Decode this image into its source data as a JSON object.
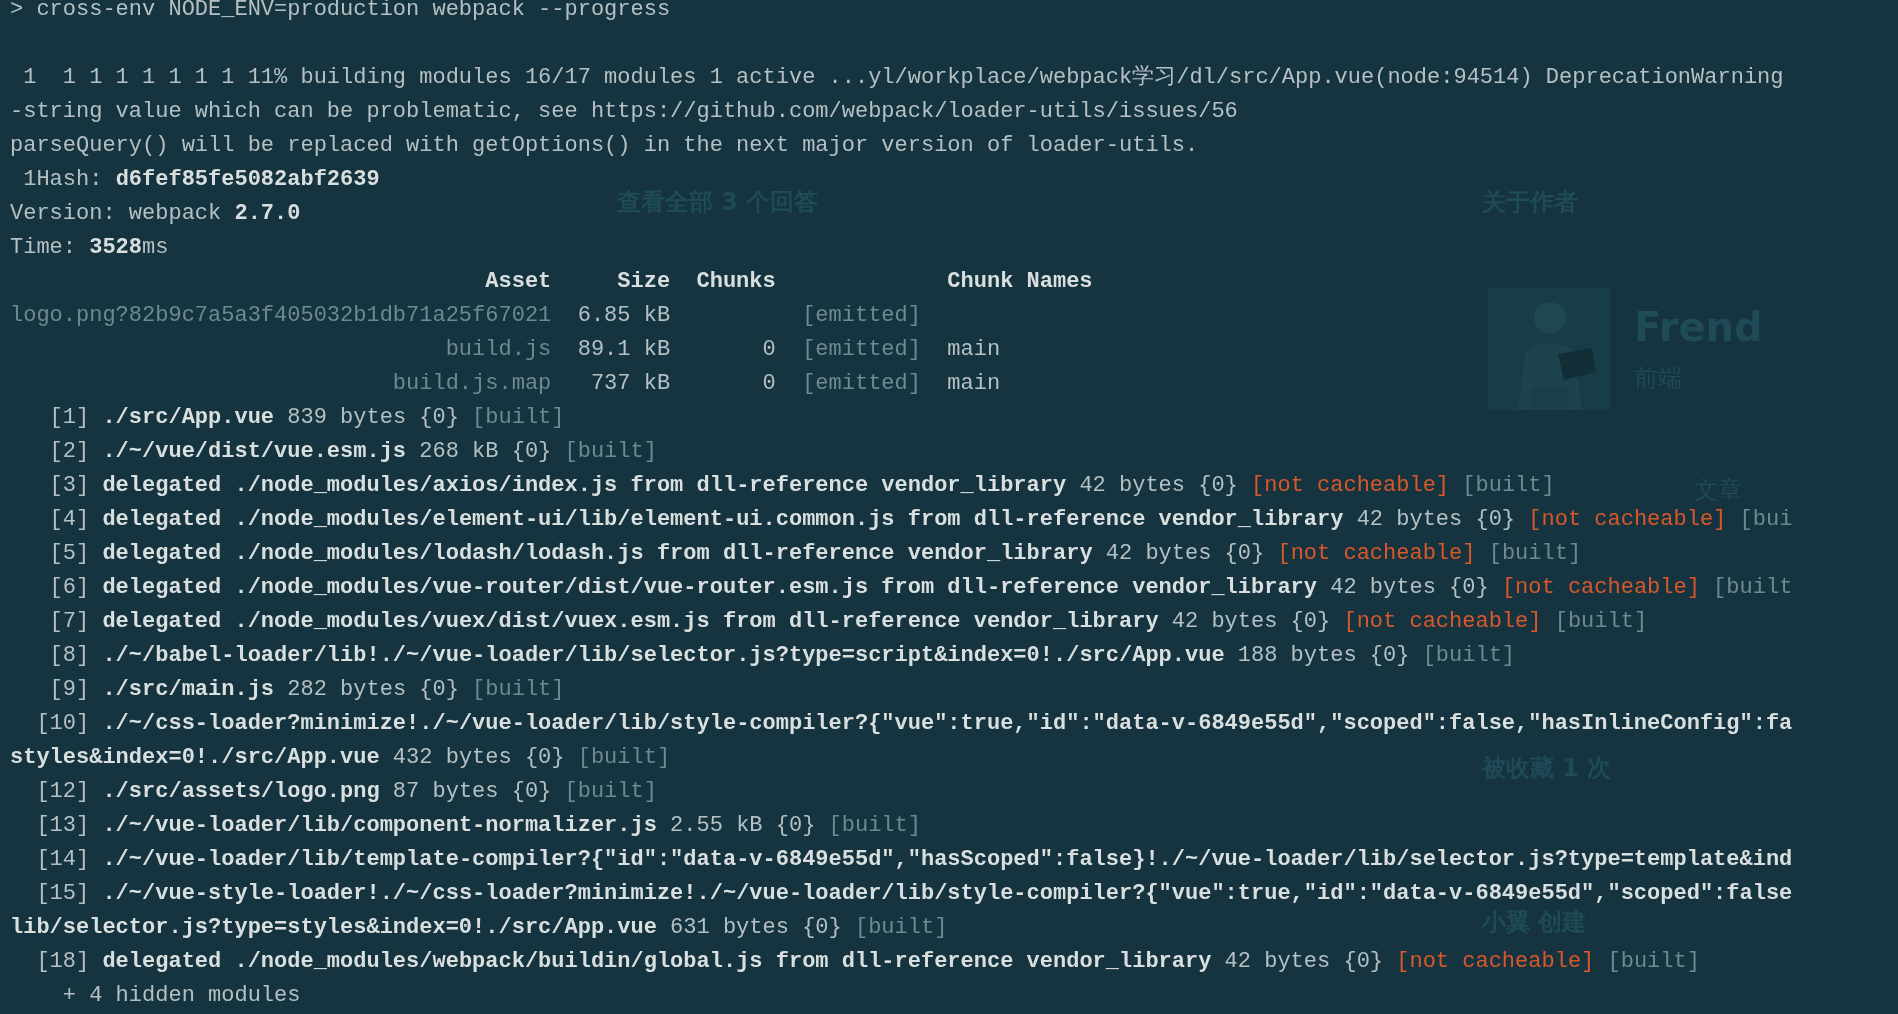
{
  "background_page": {
    "texts": [
      {
        "kind": "heading",
        "text": "查看全部 3 个回答"
      },
      {
        "kind": "heading",
        "text": "关于作者"
      },
      {
        "kind": "name",
        "text": "Frend"
      },
      {
        "kind": "label",
        "text": "前端"
      },
      {
        "kind": "label",
        "text": "文章"
      },
      {
        "kind": "heading",
        "text": "被收藏 1 次"
      },
      {
        "kind": "heading",
        "text": "小翼 创建"
      }
    ]
  },
  "terminal": {
    "lines": [
      {
        "kind": "text",
        "segments": [
          {
            "kind": "plain",
            "text": "> cross-env NODE_ENV=production webpack --progress"
          }
        ]
      },
      {
        "kind": "blank"
      },
      {
        "kind": "text",
        "segments": [
          {
            "kind": "plain",
            "text": " 1  1 1 1 1 1 1 1 11% building modules 16/17 modules 1 active ...yl/workplace/webpack学习/dl/src/App.vue(node:94514) DeprecationWarning"
          }
        ]
      },
      {
        "kind": "text",
        "segments": [
          {
            "kind": "plain",
            "text": "-string value which can be problematic, see https://github.com/webpack/loader-utils/issues/56"
          }
        ]
      },
      {
        "kind": "text",
        "segments": [
          {
            "kind": "plain",
            "text": "parseQuery() will be replaced with getOptions() in the next major version of loader-utils."
          }
        ]
      },
      {
        "kind": "text",
        "segments": [
          {
            "kind": "plain",
            "text": " 1Hash: "
          },
          {
            "kind": "bold",
            "text": "d6fef85fe5082abf2639"
          }
        ]
      },
      {
        "kind": "text",
        "segments": [
          {
            "kind": "plain",
            "text": "Version: webpack "
          },
          {
            "kind": "bold",
            "text": "2.7.0"
          }
        ]
      },
      {
        "kind": "text",
        "segments": [
          {
            "kind": "plain",
            "text": "Time: "
          },
          {
            "kind": "bold",
            "text": "3528"
          },
          {
            "kind": "plain",
            "text": "ms"
          }
        ]
      },
      {
        "kind": "text",
        "segments": [
          {
            "kind": "bold",
            "text": "                                    Asset     Size  Chunks             Chunk Names"
          }
        ]
      },
      {
        "kind": "text",
        "segments": [
          {
            "kind": "dim",
            "text": "logo.png?82b9c7a5a3f405032b1db71a25f67021"
          },
          {
            "kind": "plain",
            "text": "  6.85 kB        "
          },
          {
            "kind": "dim",
            "text": "  [emitted]"
          }
        ]
      },
      {
        "kind": "text",
        "segments": [
          {
            "kind": "dim",
            "text": "                                 build.js"
          },
          {
            "kind": "plain",
            "text": "  89.1 kB       0"
          },
          {
            "kind": "dim",
            "text": "  [emitted]"
          },
          {
            "kind": "plain",
            "text": "  main"
          }
        ]
      },
      {
        "kind": "text",
        "segments": [
          {
            "kind": "dim",
            "text": "                             build.js.map"
          },
          {
            "kind": "plain",
            "text": "   737 kB       0"
          },
          {
            "kind": "dim",
            "text": "  [emitted]"
          },
          {
            "kind": "plain",
            "text": "  main"
          }
        ]
      },
      {
        "kind": "text",
        "segments": [
          {
            "kind": "plain",
            "text": "   [1] "
          },
          {
            "kind": "bold",
            "text": "./src/App.vue"
          },
          {
            "kind": "plain",
            "text": " 839 bytes {0} "
          },
          {
            "kind": "dim",
            "text": "[built]"
          }
        ]
      },
      {
        "kind": "text",
        "segments": [
          {
            "kind": "plain",
            "text": "   [2] "
          },
          {
            "kind": "bold",
            "text": "./~/vue/dist/vue.esm.js"
          },
          {
            "kind": "plain",
            "text": " 268 kB {0} "
          },
          {
            "kind": "dim",
            "text": "[built]"
          }
        ]
      },
      {
        "kind": "text",
        "segments": [
          {
            "kind": "plain",
            "text": "   [3] "
          },
          {
            "kind": "bold",
            "text": "delegated ./node_modules/axios/index.js from dll-reference vendor_library"
          },
          {
            "kind": "plain",
            "text": " 42 bytes {0} "
          },
          {
            "kind": "warn",
            "text": "[not cacheable]"
          },
          {
            "kind": "dim",
            "text": " [built]"
          }
        ]
      },
      {
        "kind": "text",
        "segments": [
          {
            "kind": "plain",
            "text": "   [4] "
          },
          {
            "kind": "bold",
            "text": "delegated ./node_modules/element-ui/lib/element-ui.common.js from dll-reference vendor_library"
          },
          {
            "kind": "plain",
            "text": " 42 bytes {0} "
          },
          {
            "kind": "warn",
            "text": "[not cacheable]"
          },
          {
            "kind": "dim",
            "text": " [bui"
          }
        ]
      },
      {
        "kind": "text",
        "segments": [
          {
            "kind": "plain",
            "text": "   [5] "
          },
          {
            "kind": "bold",
            "text": "delegated ./node_modules/lodash/lodash.js from dll-reference vendor_library"
          },
          {
            "kind": "plain",
            "text": " 42 bytes {0} "
          },
          {
            "kind": "warn",
            "text": "[not cacheable]"
          },
          {
            "kind": "dim",
            "text": " [built]"
          }
        ]
      },
      {
        "kind": "text",
        "segments": [
          {
            "kind": "plain",
            "text": "   [6] "
          },
          {
            "kind": "bold",
            "text": "delegated ./node_modules/vue-router/dist/vue-router.esm.js from dll-reference vendor_library"
          },
          {
            "kind": "plain",
            "text": " 42 bytes {0} "
          },
          {
            "kind": "warn",
            "text": "[not cacheable]"
          },
          {
            "kind": "dim",
            "text": " [built"
          }
        ]
      },
      {
        "kind": "text",
        "segments": [
          {
            "kind": "plain",
            "text": "   [7] "
          },
          {
            "kind": "bold",
            "text": "delegated ./node_modules/vuex/dist/vuex.esm.js from dll-reference vendor_library"
          },
          {
            "kind": "plain",
            "text": " 42 bytes {0} "
          },
          {
            "kind": "warn",
            "text": "[not cacheable]"
          },
          {
            "kind": "dim",
            "text": " [built]"
          }
        ]
      },
      {
        "kind": "text",
        "segments": [
          {
            "kind": "plain",
            "text": "   [8] "
          },
          {
            "kind": "bold",
            "text": "./~/babel-loader/lib!./~/vue-loader/lib/selector.js?type=script&index=0!./src/App.vue"
          },
          {
            "kind": "plain",
            "text": " 188 bytes {0} "
          },
          {
            "kind": "dim",
            "text": "[built]"
          }
        ]
      },
      {
        "kind": "text",
        "segments": [
          {
            "kind": "plain",
            "text": "   [9] "
          },
          {
            "kind": "bold",
            "text": "./src/main.js"
          },
          {
            "kind": "plain",
            "text": " 282 bytes {0} "
          },
          {
            "kind": "dim",
            "text": "[built]"
          }
        ]
      },
      {
        "kind": "text",
        "segments": [
          {
            "kind": "plain",
            "text": "  [10] "
          },
          {
            "kind": "bold",
            "text": "./~/css-loader?minimize!./~/vue-loader/lib/style-compiler?{\"vue\":true,\"id\":\"data-v-6849e55d\",\"scoped\":false,\"hasInlineConfig\":fa"
          }
        ]
      },
      {
        "kind": "text",
        "segments": [
          {
            "kind": "bold",
            "text": "styles&index=0!./src/App.vue"
          },
          {
            "kind": "plain",
            "text": " 432 bytes {0} "
          },
          {
            "kind": "dim",
            "text": "[built]"
          }
        ]
      },
      {
        "kind": "text",
        "segments": [
          {
            "kind": "plain",
            "text": "  [12] "
          },
          {
            "kind": "bold",
            "text": "./src/assets/logo.png"
          },
          {
            "kind": "plain",
            "text": " 87 bytes {0} "
          },
          {
            "kind": "dim",
            "text": "[built]"
          }
        ]
      },
      {
        "kind": "text",
        "segments": [
          {
            "kind": "plain",
            "text": "  [13] "
          },
          {
            "kind": "bold",
            "text": "./~/vue-loader/lib/component-normalizer.js"
          },
          {
            "kind": "plain",
            "text": " 2.55 kB {0} "
          },
          {
            "kind": "dim",
            "text": "[built]"
          }
        ]
      },
      {
        "kind": "text",
        "segments": [
          {
            "kind": "plain",
            "text": "  [14] "
          },
          {
            "kind": "bold",
            "text": "./~/vue-loader/lib/template-compiler?{\"id\":\"data-v-6849e55d\",\"hasScoped\":false}!./~/vue-loader/lib/selector.js?type=template&ind"
          }
        ]
      },
      {
        "kind": "text",
        "segments": [
          {
            "kind": "plain",
            "text": "  [15] "
          },
          {
            "kind": "bold",
            "text": "./~/vue-style-loader!./~/css-loader?minimize!./~/vue-loader/lib/style-compiler?{\"vue\":true,\"id\":\"data-v-6849e55d\",\"scoped\":false"
          }
        ]
      },
      {
        "kind": "text",
        "segments": [
          {
            "kind": "bold",
            "text": "lib/selector.js?type=styles&index=0!./src/App.vue"
          },
          {
            "kind": "plain",
            "text": " 631 bytes {0} "
          },
          {
            "kind": "dim",
            "text": "[built]"
          }
        ]
      },
      {
        "kind": "text",
        "segments": [
          {
            "kind": "plain",
            "text": "  [18] "
          },
          {
            "kind": "bold",
            "text": "delegated ./node_modules/webpack/buildin/global.js from dll-reference vendor_library"
          },
          {
            "kind": "plain",
            "text": " 42 bytes {0} "
          },
          {
            "kind": "warn",
            "text": "[not cacheable]"
          },
          {
            "kind": "dim",
            "text": " [built]"
          }
        ]
      },
      {
        "kind": "text",
        "segments": [
          {
            "kind": "plain",
            "text": "    + 4 hidden modules"
          }
        ]
      }
    ]
  }
}
